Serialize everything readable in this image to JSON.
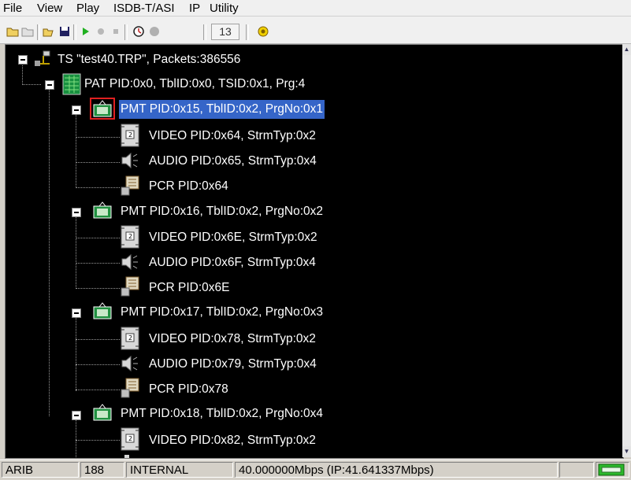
{
  "menu": [
    "File",
    "View",
    "Play",
    "ISDB-T/ASI",
    "IP",
    "Utility"
  ],
  "toolbar": {
    "icons": [
      "open-folder-icon",
      "folder-icon",
      "open-file-icon",
      "save-icon",
      "play-icon",
      "record-icon",
      "stop-icon",
      "timer-icon",
      "circle-icon",
      "number-field",
      "settings-icon"
    ],
    "number_value": "13"
  },
  "tree": {
    "root": "TS \"test40.TRP\", Packets:386556",
    "pat": "PAT PID:0x0, TblID:0x0, TSID:0x1, Prg:4",
    "programs": [
      {
        "pmt": "PMT PID:0x15, TblID:0x2, PrgNo:0x1",
        "selected": true,
        "video": "VIDEO PID:0x64, StrmTyp:0x2",
        "audio": "AUDIO PID:0x65, StrmTyp:0x4",
        "pcr": "PCR PID:0x64"
      },
      {
        "pmt": "PMT PID:0x16, TblID:0x2, PrgNo:0x2",
        "video": "VIDEO PID:0x6E, StrmTyp:0x2",
        "audio": "AUDIO PID:0x6F, StrmTyp:0x4",
        "pcr": "PCR PID:0x6E"
      },
      {
        "pmt": "PMT PID:0x17, TblID:0x2, PrgNo:0x3",
        "video": "VIDEO PID:0x78, StrmTyp:0x2",
        "audio": "AUDIO PID:0x79, StrmTyp:0x4",
        "pcr": "PCR PID:0x78"
      },
      {
        "pmt": "PMT PID:0x18, TblID:0x2, PrgNo:0x4",
        "video": "VIDEO PID:0x82, StrmTyp:0x2"
      }
    ]
  },
  "status": {
    "standard": "ARIB",
    "packet_size": "188",
    "clock": "INTERNAL",
    "rate": "40.000000Mbps (IP:41.641337Mbps)",
    "empty": "",
    "indicator_icon": "signal-indicator-icon"
  },
  "colors": {
    "tree_bg": "#000000",
    "tree_text": "#ffffff",
    "selection": "#3565c8",
    "indicator": "#2bb82b"
  }
}
